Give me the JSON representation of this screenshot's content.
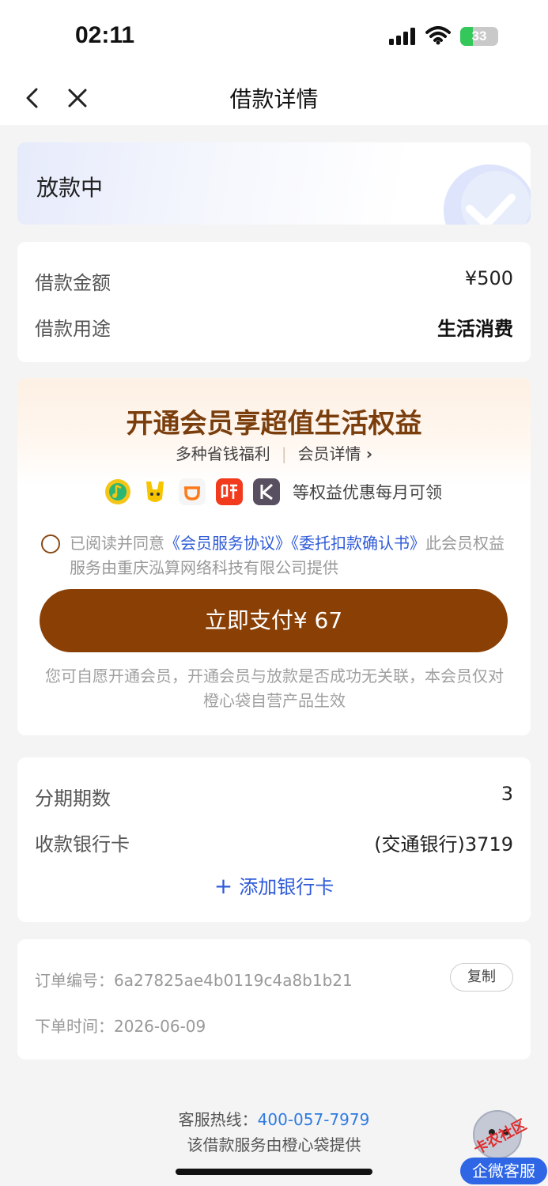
{
  "status_bar": {
    "time": "02:11",
    "battery_percent": "33"
  },
  "nav": {
    "title": "借款详情"
  },
  "loan_status": {
    "text": "放款中"
  },
  "loan_info": {
    "amount_label": "借款金额",
    "amount_value": "¥500",
    "purpose_label": "借款用途",
    "purpose_value": "生活消费"
  },
  "membership": {
    "title": "开通会员享超值生活权益",
    "subtitle": "多种省钱福利",
    "details_link": "会员详情",
    "perk_icons": [
      "qq-music-icon",
      "mango-tv-icon",
      "didi-icon",
      "ximalaya-icon",
      "keep-icon"
    ],
    "perks_text": "等权益优惠每月可领",
    "agree_prefix": "已阅读并同意",
    "agree_link_1": "《会员服务协议》",
    "agree_link_2": "《委托扣款确认书》",
    "agree_suffix": "此会员权益服务由重庆泓算网络科技有限公司提供",
    "pay_button": "立即支付¥ 67",
    "note": "您可自愿开通会员，开通会员与放款是否成功无关联，本会员仅对橙心袋自营产品生效"
  },
  "installment": {
    "periods_label": "分期期数",
    "periods_value": "3",
    "bank_label": "收款银行卡",
    "bank_value": "(交通银行)3719",
    "add_card": "添加银行卡"
  },
  "order": {
    "number_label": "订单编号：",
    "number_value": "6a27825ae4b0119c4a8b1b21",
    "copy_button": "复制",
    "time_label": "下单时间：",
    "time_value": "2026-06-09"
  },
  "footer": {
    "hotline_label": "客服热线：",
    "hotline_value": "400-057-7979",
    "provider": "该借款服务由橙心袋提供"
  },
  "float_cs": {
    "stamp": "卡农社区",
    "label": "企微客服"
  },
  "colors": {
    "accent_brown": "#8a3f04",
    "link_blue": "#2f5bd8",
    "cs_blue": "#2e66e6"
  }
}
